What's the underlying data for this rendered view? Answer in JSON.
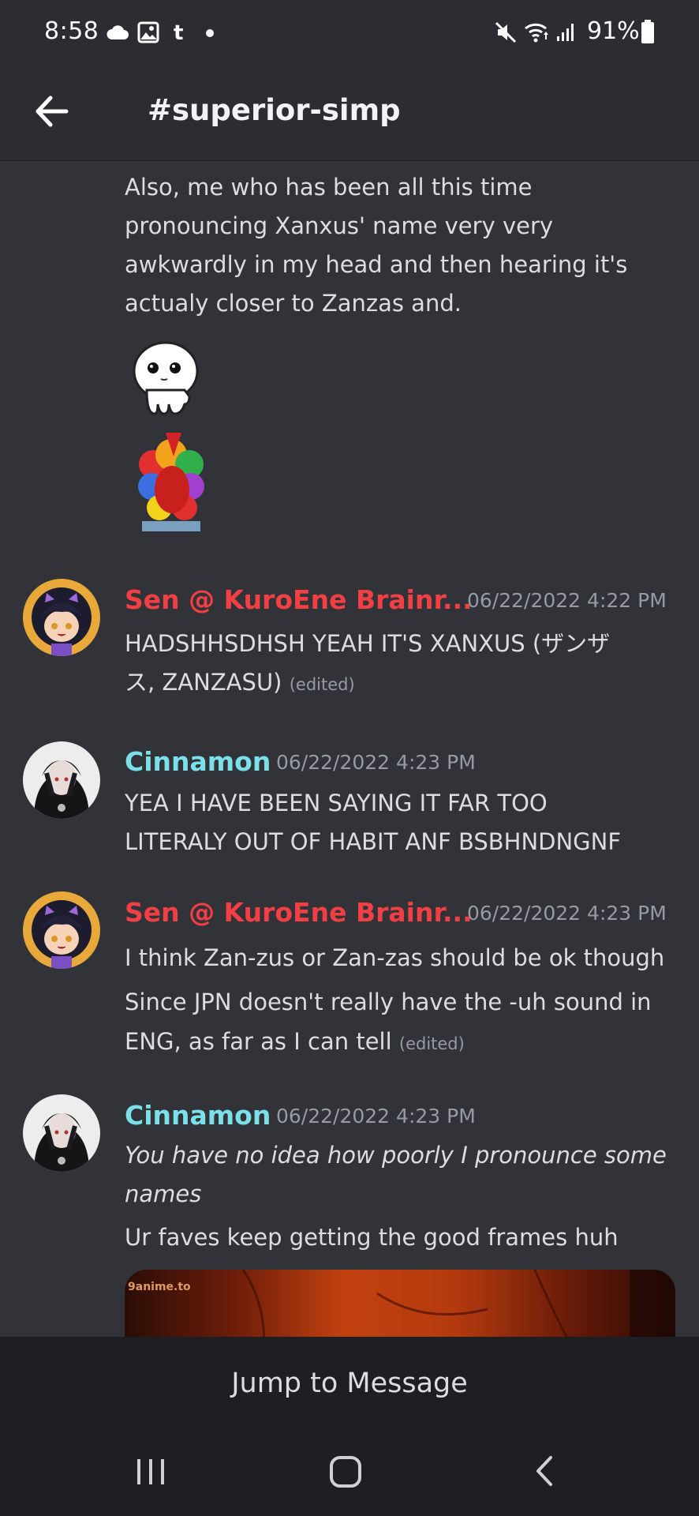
{
  "status_bar": {
    "time": "8:58",
    "battery": "91%",
    "left_icons": [
      "cloud-icon",
      "gallery-icon",
      "tumblr-icon",
      "dot-icon"
    ],
    "right_icons": [
      "mute-icon",
      "wifi-icon",
      "signal-icon",
      "battery-icon"
    ]
  },
  "header": {
    "channel": "#superior-simp",
    "back_icon": "arrow-left-icon"
  },
  "messages": [
    {
      "continuation": true,
      "text": "Also, me who has been all this time pronouncing Xanxus' name very very awkwardly in my head and then hearing it's actualy closer to Zanzas and.",
      "stickers": [
        "ghost-sticker",
        "clown-sticker"
      ]
    },
    {
      "author": "Sen @ KuroEne Brainr...",
      "timestamp": "06/22/2022 4:22 PM",
      "lines": [
        "HADSHHSDHSH YEAH IT'S XANXUS (ザンザ",
        "ス, ZANZASU)"
      ],
      "edited": "(edited)"
    },
    {
      "author": "Cinnamon",
      "timestamp": "06/22/2022 4:23 PM",
      "lines": [
        "YEA I HAVE BEEN SAYING IT FAR TOO",
        "LITERALY OUT OF HABIT ANF BSBHNDNGNF"
      ]
    },
    {
      "author": "Sen @ KuroEne Brainr...",
      "timestamp": "06/22/2022 4:23 PM",
      "line1": "I think Zan-zus or Zan-zas should be ok though",
      "line2": "Since JPN doesn't really have the -uh sound in",
      "line3": "ENG, as far as I can tell",
      "edited": "(edited)"
    },
    {
      "author": "Cinnamon",
      "timestamp": "06/22/2022 4:23 PM",
      "italic_lines": [
        "You have no idea how poorly I pronounce some",
        "names"
      ],
      "line": "Ur faves keep getting the good frames huh",
      "image_watermark": "9anime.to"
    }
  ],
  "jump_to_message": "Jump to Message",
  "nav_bar": {
    "buttons": [
      "recent-apps-icon",
      "home-icon",
      "back-icon"
    ]
  }
}
